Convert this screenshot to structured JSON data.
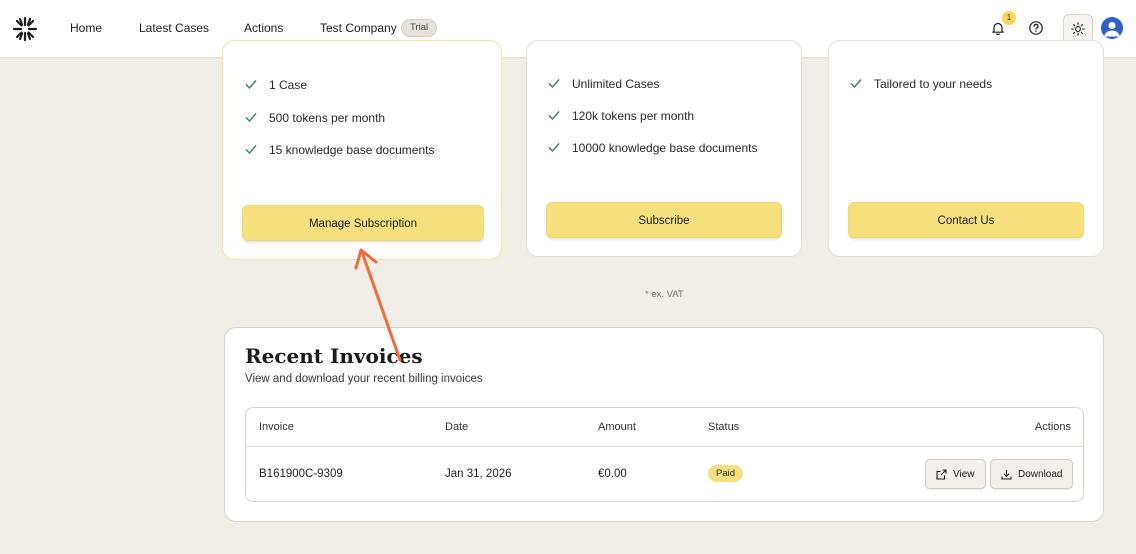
{
  "nav": {
    "items": [
      "Home",
      "Latest Cases",
      "Actions"
    ],
    "company": "Test Company",
    "badge": "Trial",
    "notification_count": "1"
  },
  "plans": [
    {
      "features": [
        "1 Case",
        "500 tokens per month",
        "15 knowledge base documents"
      ],
      "button": "Manage Subscription"
    },
    {
      "features": [
        "Unlimited Cases",
        "120k tokens per month",
        "10000 knowledge base documents"
      ],
      "button": "Subscribe"
    },
    {
      "features": [
        "Tailored to your needs"
      ],
      "button": "Contact Us"
    }
  ],
  "vat_note": "* ex. VAT",
  "invoices": {
    "title": "Recent Invoices",
    "subtitle": "View and download your recent billing invoices",
    "columns": [
      "Invoice",
      "Date",
      "Amount",
      "Status",
      "Actions"
    ],
    "rows": [
      {
        "invoice": "B161900C-9309",
        "date": "Jan 31, 2026",
        "amount": "€0.00",
        "status": "Paid"
      }
    ],
    "view_label": "View",
    "download_label": "Download"
  },
  "colors": {
    "accent": "#f6e07d",
    "annotation_arrow": "#f26b3a",
    "background": "#f1eee8"
  }
}
